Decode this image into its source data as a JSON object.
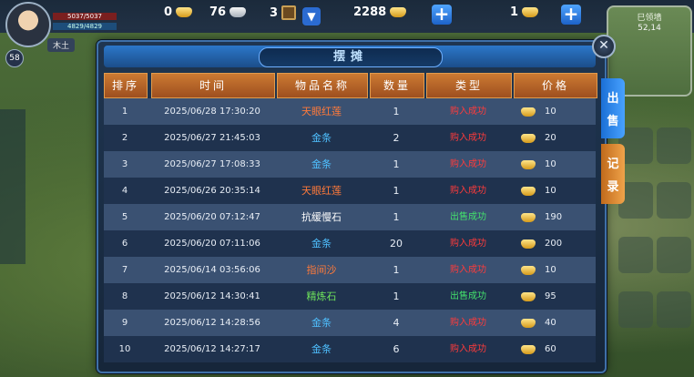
{
  "colors": {
    "orange_item": "#ff7a3a",
    "blue_item": "#4fc0ff",
    "white_item": "#ffffff",
    "green_item": "#6ee35b",
    "buy_status": "#ff3b3b",
    "sell_status": "#44e16c"
  },
  "hud": {
    "hp_text": "5037/5037",
    "mp_text": "4829/4829",
    "player_tag": "木土",
    "level": "58",
    "gold_ingot": "0",
    "silver_ingot": "76",
    "coin": "3",
    "yuanbao_balance": "2288",
    "gold_balance": "1",
    "plus_label": "+",
    "dropdown_icon": "chevron-down-icon",
    "minimap": {
      "area_name": "巳领墙",
      "coord": "52,14"
    }
  },
  "modal": {
    "title": "摆摊",
    "close_label": "✕",
    "tabs": [
      {
        "label_top": "出",
        "label_bottom": "售"
      },
      {
        "label_top": "记",
        "label_bottom": "录"
      }
    ],
    "columns": {
      "rank": "排序",
      "time": "时间",
      "item": "物品名称",
      "qty": "数量",
      "type": "类型",
      "price": "价格"
    },
    "rows": [
      {
        "rank": "1",
        "time": "2025/06/28 17:30:20",
        "item": "天眼红莲",
        "item_color": "#ff7a3a",
        "qty": "1",
        "type": "购入成功",
        "type_color": "#ff3b3b",
        "price": "10"
      },
      {
        "rank": "2",
        "time": "2025/06/27 21:45:03",
        "item": "金条",
        "item_color": "#4fc0ff",
        "qty": "2",
        "type": "购入成功",
        "type_color": "#ff3b3b",
        "price": "20"
      },
      {
        "rank": "3",
        "time": "2025/06/27 17:08:33",
        "item": "金条",
        "item_color": "#4fc0ff",
        "qty": "1",
        "type": "购入成功",
        "type_color": "#ff3b3b",
        "price": "10"
      },
      {
        "rank": "4",
        "time": "2025/06/26 20:35:14",
        "item": "天眼红莲",
        "item_color": "#ff7a3a",
        "qty": "1",
        "type": "购入成功",
        "type_color": "#ff3b3b",
        "price": "10"
      },
      {
        "rank": "5",
        "time": "2025/06/20 07:12:47",
        "item": "抗缓慢石",
        "item_color": "#ffffff",
        "qty": "1",
        "type": "出售成功",
        "type_color": "#44e16c",
        "price": "190"
      },
      {
        "rank": "6",
        "time": "2025/06/20 07:11:06",
        "item": "金条",
        "item_color": "#4fc0ff",
        "qty": "20",
        "type": "购入成功",
        "type_color": "#ff3b3b",
        "price": "200"
      },
      {
        "rank": "7",
        "time": "2025/06/14 03:56:06",
        "item": "指间沙",
        "item_color": "#ff7a3a",
        "qty": "1",
        "type": "购入成功",
        "type_color": "#ff3b3b",
        "price": "10"
      },
      {
        "rank": "8",
        "time": "2025/06/12 14:30:41",
        "item": "精炼石",
        "item_color": "#6ee35b",
        "qty": "1",
        "type": "出售成功",
        "type_color": "#44e16c",
        "price": "95"
      },
      {
        "rank": "9",
        "time": "2025/06/12 14:28:56",
        "item": "金条",
        "item_color": "#4fc0ff",
        "qty": "4",
        "type": "购入成功",
        "type_color": "#ff3b3b",
        "price": "40"
      },
      {
        "rank": "10",
        "time": "2025/06/12 14:27:17",
        "item": "金条",
        "item_color": "#4fc0ff",
        "qty": "6",
        "type": "购入成功",
        "type_color": "#ff3b3b",
        "price": "60"
      }
    ]
  }
}
